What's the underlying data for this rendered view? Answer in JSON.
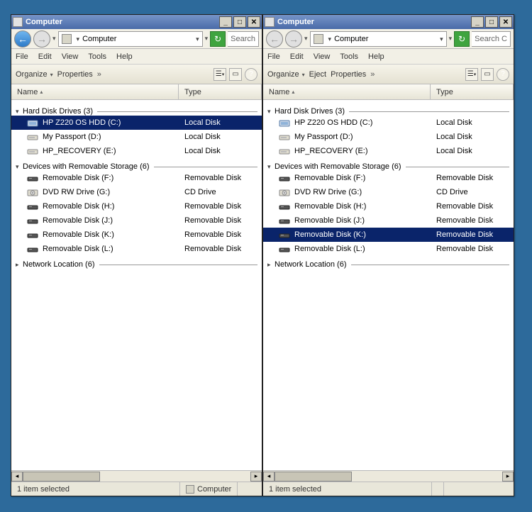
{
  "windows": [
    {
      "title": "Computer",
      "address": "Computer",
      "search_placeholder": "Search",
      "nav_back_enabled": true,
      "menubar": [
        "File",
        "Edit",
        "View",
        "Tools",
        "Help"
      ],
      "toolbar": {
        "organize": "Organize",
        "properties": "Properties"
      },
      "columns": {
        "name": "Name",
        "type": "Type"
      },
      "groups": [
        {
          "header": "Hard Disk Drives (3)",
          "expanded": true,
          "items": [
            {
              "name": "HP Z220 OS HDD (C:)",
              "type": "Local Disk",
              "icon": "hdd",
              "selected": true
            },
            {
              "name": "My Passport (D:)",
              "type": "Local Disk",
              "icon": "ext"
            },
            {
              "name": "HP_RECOVERY (E:)",
              "type": "Local Disk",
              "icon": "ext"
            }
          ]
        },
        {
          "header": "Devices with Removable Storage (6)",
          "expanded": true,
          "items": [
            {
              "name": "Removable Disk (F:)",
              "type": "Removable Disk",
              "icon": "rem"
            },
            {
              "name": "DVD RW Drive (G:)",
              "type": "CD Drive",
              "icon": "dvd"
            },
            {
              "name": "Removable Disk (H:)",
              "type": "Removable Disk",
              "icon": "rem"
            },
            {
              "name": "Removable Disk (J:)",
              "type": "Removable Disk",
              "icon": "rem"
            },
            {
              "name": "Removable Disk (K:)",
              "type": "Removable Disk",
              "icon": "rem"
            },
            {
              "name": "Removable Disk (L:)",
              "type": "Removable Disk",
              "icon": "rem"
            }
          ]
        },
        {
          "header": "Network Location (6)",
          "expanded": false,
          "items": []
        }
      ],
      "status_left": "1 item selected",
      "status_right": "Computer"
    },
    {
      "title": "Computer",
      "address": "Computer",
      "search_placeholder": "Search C",
      "nav_back_enabled": false,
      "menubar": [
        "File",
        "Edit",
        "View",
        "Tools",
        "Help"
      ],
      "toolbar": {
        "organize": "Organize",
        "eject": "Eject",
        "properties": "Properties"
      },
      "columns": {
        "name": "Name",
        "type": "Type"
      },
      "groups": [
        {
          "header": "Hard Disk Drives (3)",
          "expanded": true,
          "items": [
            {
              "name": "HP Z220 OS HDD (C:)",
              "type": "Local Disk",
              "icon": "hdd"
            },
            {
              "name": "My Passport (D:)",
              "type": "Local Disk",
              "icon": "ext"
            },
            {
              "name": "HP_RECOVERY (E:)",
              "type": "Local Disk",
              "icon": "ext"
            }
          ]
        },
        {
          "header": "Devices with Removable Storage (6)",
          "expanded": true,
          "items": [
            {
              "name": "Removable Disk (F:)",
              "type": "Removable Disk",
              "icon": "rem"
            },
            {
              "name": "DVD RW Drive (G:)",
              "type": "CD Drive",
              "icon": "dvd"
            },
            {
              "name": "Removable Disk (H:)",
              "type": "Removable Disk",
              "icon": "rem"
            },
            {
              "name": "Removable Disk (J:)",
              "type": "Removable Disk",
              "icon": "rem"
            },
            {
              "name": "Removable Disk (K:)",
              "type": "Removable Disk",
              "icon": "rem",
              "selected": true
            },
            {
              "name": "Removable Disk (L:)",
              "type": "Removable Disk",
              "icon": "rem"
            }
          ]
        },
        {
          "header": "Network Location (6)",
          "expanded": false,
          "items": []
        }
      ],
      "status_left": "1 item selected",
      "status_right": ""
    }
  ]
}
